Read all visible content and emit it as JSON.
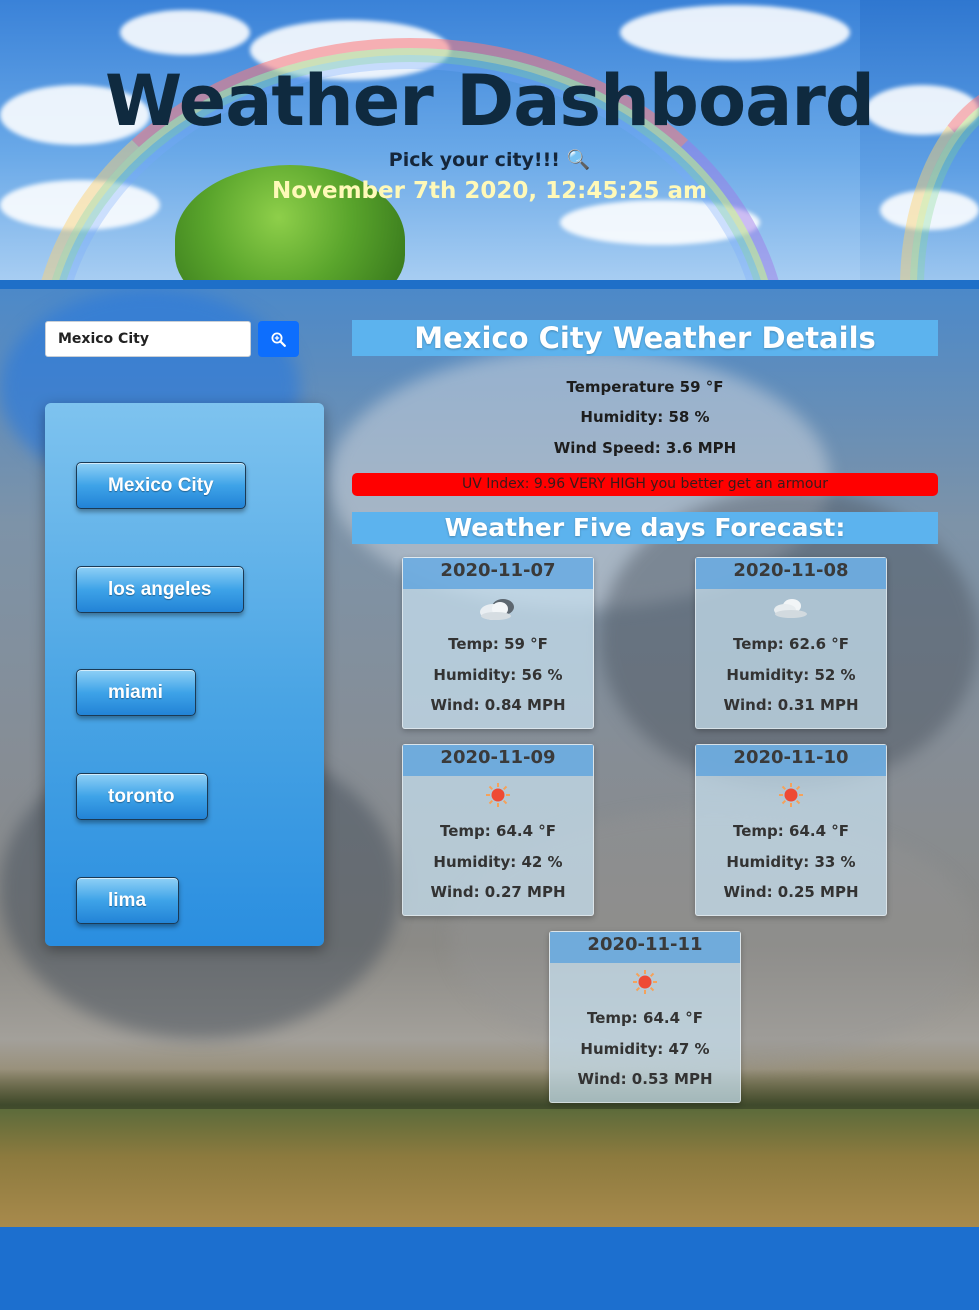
{
  "header": {
    "title": "Weather Dashboard",
    "subtitle": "Pick your city!!! 🔍",
    "datetime": "November 7th 2020, 12:45:25 am"
  },
  "search": {
    "value": "Mexico City",
    "button_icon": "zoom-in-icon"
  },
  "history": {
    "cities": [
      "Mexico City",
      "los angeles",
      "miami",
      "toronto",
      "lima"
    ]
  },
  "details": {
    "title": "Mexico City Weather Details",
    "temperature": "Temperature 59 °F",
    "humidity": "Humidity: 58 %",
    "wind": "Wind Speed: 3.6 MPH",
    "uv": "UV Index: 9.96 VERY HIGH you better get an armour",
    "uv_color": "#ff0000"
  },
  "forecast": {
    "title": "Weather Five days Forecast:",
    "days": [
      {
        "date": "2020-11-07",
        "icon": "cloudy-icon",
        "temp": "Temp: 59 °F",
        "humidity": "Humidity: 56 %",
        "wind": "Wind: 0.84 MPH"
      },
      {
        "date": "2020-11-08",
        "icon": "cloud-icon",
        "temp": "Temp: 62.6 °F",
        "humidity": "Humidity: 52 %",
        "wind": "Wind: 0.31 MPH"
      },
      {
        "date": "2020-11-09",
        "icon": "sun-icon",
        "temp": "Temp: 64.4 °F",
        "humidity": "Humidity: 42 %",
        "wind": "Wind: 0.27 MPH"
      },
      {
        "date": "2020-11-10",
        "icon": "sun-icon",
        "temp": "Temp: 64.4 °F",
        "humidity": "Humidity: 33 %",
        "wind": "Wind: 0.25 MPH"
      },
      {
        "date": "2020-11-11",
        "icon": "sun-icon",
        "temp": "Temp: 64.4 °F",
        "humidity": "Humidity: 47 %",
        "wind": "Wind: 0.53 MPH"
      }
    ]
  },
  "colors": {
    "accent": "#5cb3ee",
    "search_button": "#0d6efd",
    "date_text": "#fff9b8"
  }
}
